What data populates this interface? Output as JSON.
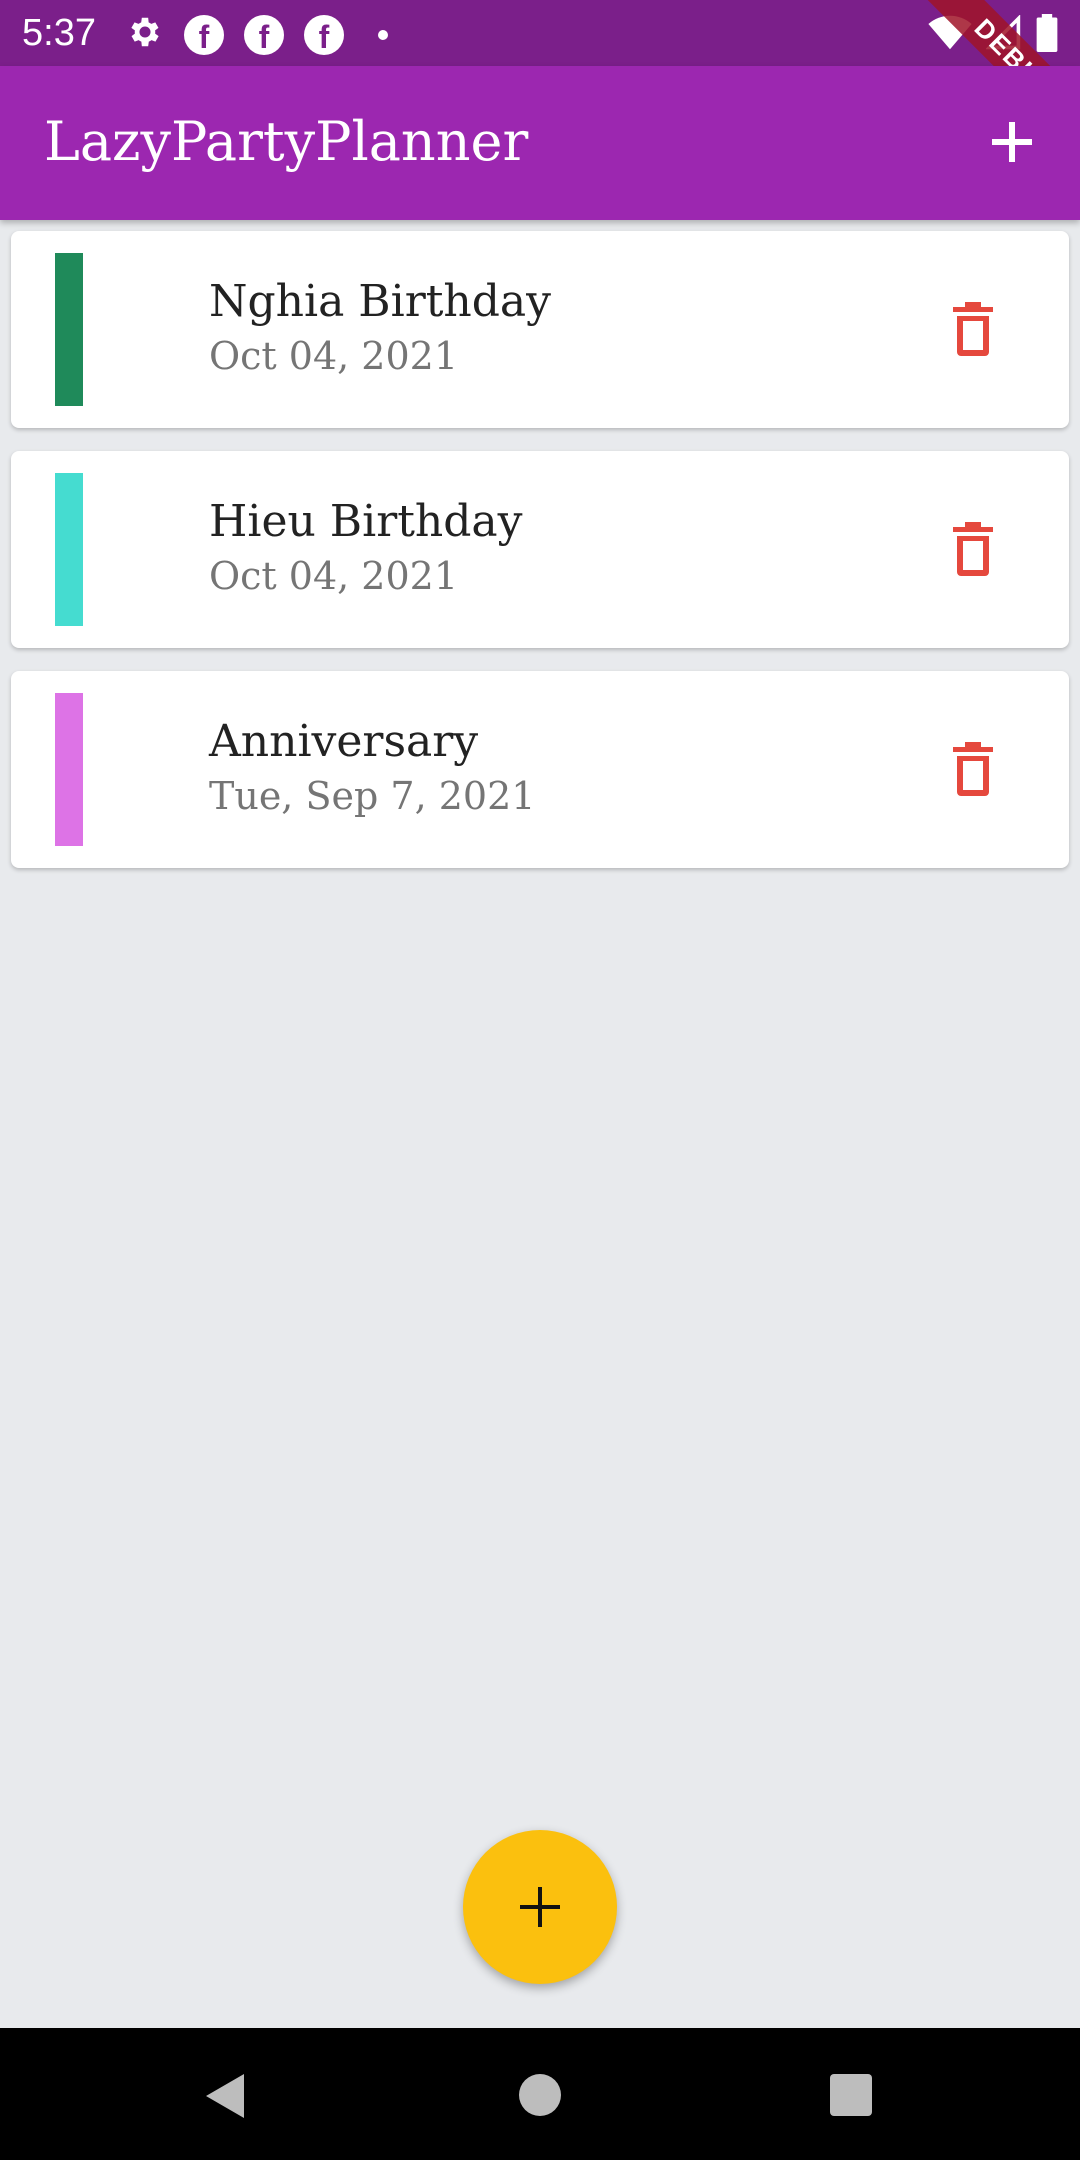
{
  "status_bar": {
    "time": "5:37"
  },
  "debug_banner": "DEBUG",
  "app_bar": {
    "title": "LazyPartyPlanner"
  },
  "events": [
    {
      "title": "Nghia Birthday",
      "date": "Oct 04, 2021",
      "color": "#1f8a5a"
    },
    {
      "title": "Hieu Birthday",
      "date": "Oct 04, 2021",
      "color": "#45dcd0"
    },
    {
      "title": "Anniversary",
      "date": "Tue, Sep 7, 2021",
      "color": "#dd73e6"
    }
  ],
  "colors": {
    "status_bar": "#7b1f8a",
    "app_bar": "#9c27b0",
    "background": "#e8eaed",
    "delete_icon": "#e5483d",
    "fab": "#fbc00e"
  },
  "icons": {
    "status_left": [
      "gear-icon",
      "facebook-icon",
      "facebook-icon",
      "facebook-icon",
      "dot-icon"
    ],
    "status_right": [
      "wifi-icon",
      "signal-icon",
      "battery-icon"
    ],
    "app_bar_action": "plus-icon",
    "event_action": "trash-icon",
    "fab": "plus-icon",
    "nav": [
      "back-icon",
      "home-icon",
      "recents-icon"
    ]
  }
}
